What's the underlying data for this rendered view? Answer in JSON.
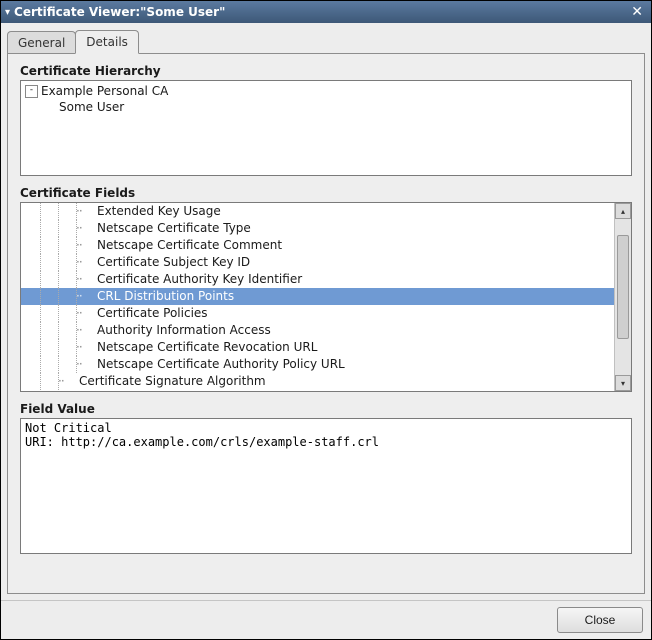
{
  "window": {
    "title": "Certificate Viewer:\"Some User\""
  },
  "tabs": [
    {
      "label": "General",
      "active": false
    },
    {
      "label": "Details",
      "active": true
    }
  ],
  "hierarchy": {
    "label": "Certificate Hierarchy",
    "items": [
      {
        "label": "Example Personal CA",
        "indent": 0,
        "expandable": true,
        "expanded": true
      },
      {
        "label": "Some User",
        "indent": 1,
        "expandable": false
      }
    ]
  },
  "fields": {
    "label": "Certificate Fields",
    "items": [
      {
        "label": "Extended Key Usage",
        "indent": 2,
        "selected": false
      },
      {
        "label": "Netscape Certificate Type",
        "indent": 2,
        "selected": false
      },
      {
        "label": "Netscape Certificate Comment",
        "indent": 2,
        "selected": false
      },
      {
        "label": "Certificate Subject Key ID",
        "indent": 2,
        "selected": false
      },
      {
        "label": "Certificate Authority Key Identifier",
        "indent": 2,
        "selected": false
      },
      {
        "label": "CRL Distribution Points",
        "indent": 2,
        "selected": true
      },
      {
        "label": "Certificate Policies",
        "indent": 2,
        "selected": false
      },
      {
        "label": "Authority Information Access",
        "indent": 2,
        "selected": false
      },
      {
        "label": "Netscape Certificate Revocation URL",
        "indent": 2,
        "selected": false
      },
      {
        "label": "Netscape Certificate Authority Policy URL",
        "indent": 2,
        "selected": false
      },
      {
        "label": "Certificate Signature Algorithm",
        "indent": 1,
        "selected": false
      }
    ],
    "scroll_thumb": {
      "top_pct": 10,
      "height_pct": 65
    }
  },
  "fieldValue": {
    "label": "Field Value",
    "text": "Not Critical\nURI: http://ca.example.com/crls/example-staff.crl"
  },
  "buttons": {
    "close": "Close"
  }
}
